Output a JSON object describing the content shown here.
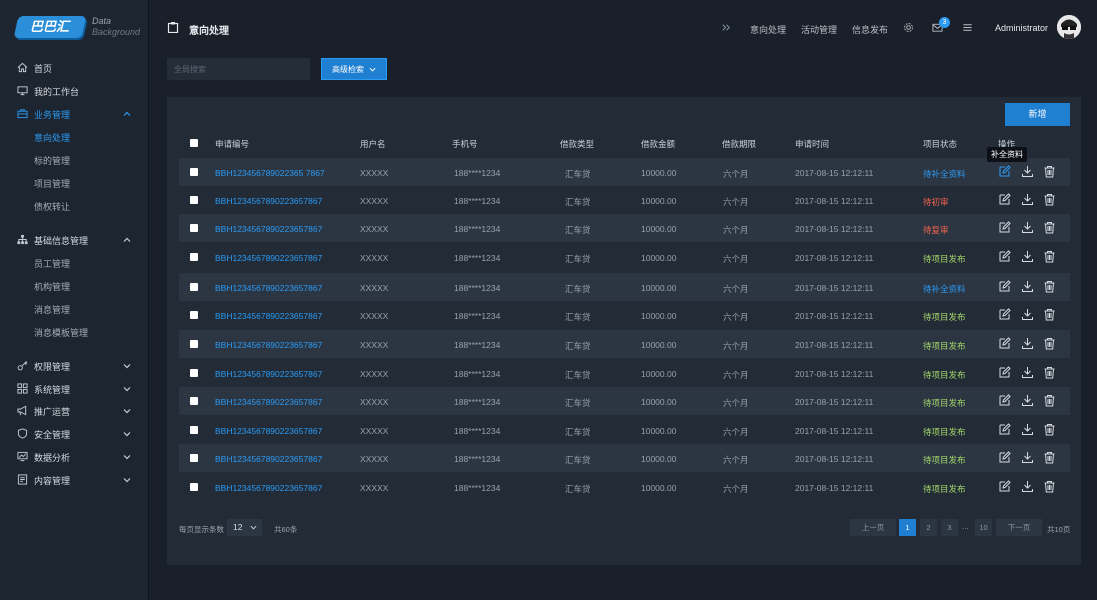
{
  "logo": {
    "mark": "巴巴汇",
    "line1": "Data",
    "line2": "Background"
  },
  "sidebar": {
    "items": [
      {
        "label": "首页",
        "icon": "home-icon"
      },
      {
        "label": "我的工作台",
        "icon": "monitor-icon"
      },
      {
        "label": "业务管理",
        "icon": "briefcase-icon"
      },
      {
        "label": "意向处理"
      },
      {
        "label": "标的管理"
      },
      {
        "label": "项目管理"
      },
      {
        "label": "债权转让"
      },
      {
        "label": "基础信息管理",
        "icon": "sitemap-icon"
      },
      {
        "label": "员工管理"
      },
      {
        "label": "机构管理"
      },
      {
        "label": "消息管理"
      },
      {
        "label": "消息模板管理"
      },
      {
        "label": "权限管理",
        "icon": "key-icon"
      },
      {
        "label": "系统管理",
        "icon": "grid-icon"
      },
      {
        "label": "推广运营",
        "icon": "megaphone-icon"
      },
      {
        "label": "安全管理",
        "icon": "shield-icon"
      },
      {
        "label": "数据分析",
        "icon": "chart-icon"
      },
      {
        "label": "内容管理",
        "icon": "document-icon"
      }
    ]
  },
  "header": {
    "title": "意向处理",
    "links": [
      "意向处理",
      "活动管理",
      "信息发布"
    ],
    "mail_count": "3",
    "user": "Administrator"
  },
  "search": {
    "placeholder": "全局搜索"
  },
  "advanced_search_label": "高级检索",
  "add_button_label": "新增",
  "table": {
    "columns": [
      "申请编号",
      "用户名",
      "手机号",
      "借款类型",
      "借款金额",
      "借款期限",
      "申请时间",
      "项目状态",
      "操作"
    ],
    "rows": [
      {
        "id": "BBH123456789022365 7867",
        "user": "XXXXX",
        "phone": "188****1234",
        "type": "汇车贷",
        "amount": "10000.00",
        "term": "六个月",
        "time": "2017-08-15  12:12:11",
        "status": "待补全资料",
        "status_color": "blue"
      },
      {
        "id": "BBH1234567890223657867",
        "user": "XXXXX",
        "phone": "188****1234",
        "type": "汇车贷",
        "amount": "10000.00",
        "term": "六个月",
        "time": "2017-08-15  12:12:11",
        "status": "待初审",
        "status_color": "red"
      },
      {
        "id": "BBH1234567890223657867",
        "user": "XXXXX",
        "phone": "188****1234",
        "type": "汇车贷",
        "amount": "10000.00",
        "term": "六个月",
        "time": "2017-08-15  12:12:11",
        "status": "待复审",
        "status_color": "red"
      },
      {
        "id": "BBH1234567890223657867",
        "user": "XXXXX",
        "phone": "188****1234",
        "type": "汇车贷",
        "amount": "10000.00",
        "term": "六个月",
        "time": "2017-08-15  12:12:11",
        "status": "待项目发布",
        "status_color": "green"
      },
      {
        "id": "BBH1234567890223657867",
        "user": "XXXXX",
        "phone": "188****1234",
        "type": "汇车贷",
        "amount": "10000.00",
        "term": "六个月",
        "time": "2017-08-15  12:12:11",
        "status": "待补全资料",
        "status_color": "blue"
      },
      {
        "id": "BBH1234567890223657867",
        "user": "XXXXX",
        "phone": "188****1234",
        "type": "汇车贷",
        "amount": "10000.00",
        "term": "六个月",
        "time": "2017-08-15  12:12:11",
        "status": "待项目发布",
        "status_color": "green"
      },
      {
        "id": "BBH1234567890223657867",
        "user": "XXXXX",
        "phone": "188****1234",
        "type": "汇车贷",
        "amount": "10000.00",
        "term": "六个月",
        "time": "2017-08-15  12:12:11",
        "status": "待项目发布",
        "status_color": "green"
      },
      {
        "id": "BBH1234567890223657867",
        "user": "XXXXX",
        "phone": "188****1234",
        "type": "汇车贷",
        "amount": "10000.00",
        "term": "六个月",
        "time": "2017-08-15  12:12:11",
        "status": "待项目发布",
        "status_color": "green"
      },
      {
        "id": "BBH1234567890223657867",
        "user": "XXXXX",
        "phone": "188****1234",
        "type": "汇车贷",
        "amount": "10000.00",
        "term": "六个月",
        "time": "2017-08-15  12:12:11",
        "status": "待项目发布",
        "status_color": "green"
      },
      {
        "id": "BBH1234567890223657867",
        "user": "XXXXX",
        "phone": "188****1234",
        "type": "汇车贷",
        "amount": "10000.00",
        "term": "六个月",
        "time": "2017-08-15  12:12:11",
        "status": "待项目发布",
        "status_color": "green"
      },
      {
        "id": "BBH1234567890223657867",
        "user": "XXXXX",
        "phone": "188****1234",
        "type": "汇车贷",
        "amount": "10000.00",
        "term": "六个月",
        "time": "2017-08-15  12:12:11",
        "status": "待项目发布",
        "status_color": "green"
      },
      {
        "id": "BBH1234567890223657867",
        "user": "XXXXX",
        "phone": "188****1234",
        "type": "汇车贷",
        "amount": "10000.00",
        "term": "六个月",
        "time": "2017-08-15  12:12:11",
        "status": "待项目发布",
        "status_color": "green"
      }
    ]
  },
  "tooltip": "补全资料",
  "footer": {
    "per_page_label": "每页显示条数",
    "page_size": "12",
    "total": "共60条",
    "prev": "上一页",
    "next": "下一页",
    "pages": [
      "1",
      "2",
      "3",
      "...",
      "10"
    ],
    "total_pages": "共10页"
  }
}
